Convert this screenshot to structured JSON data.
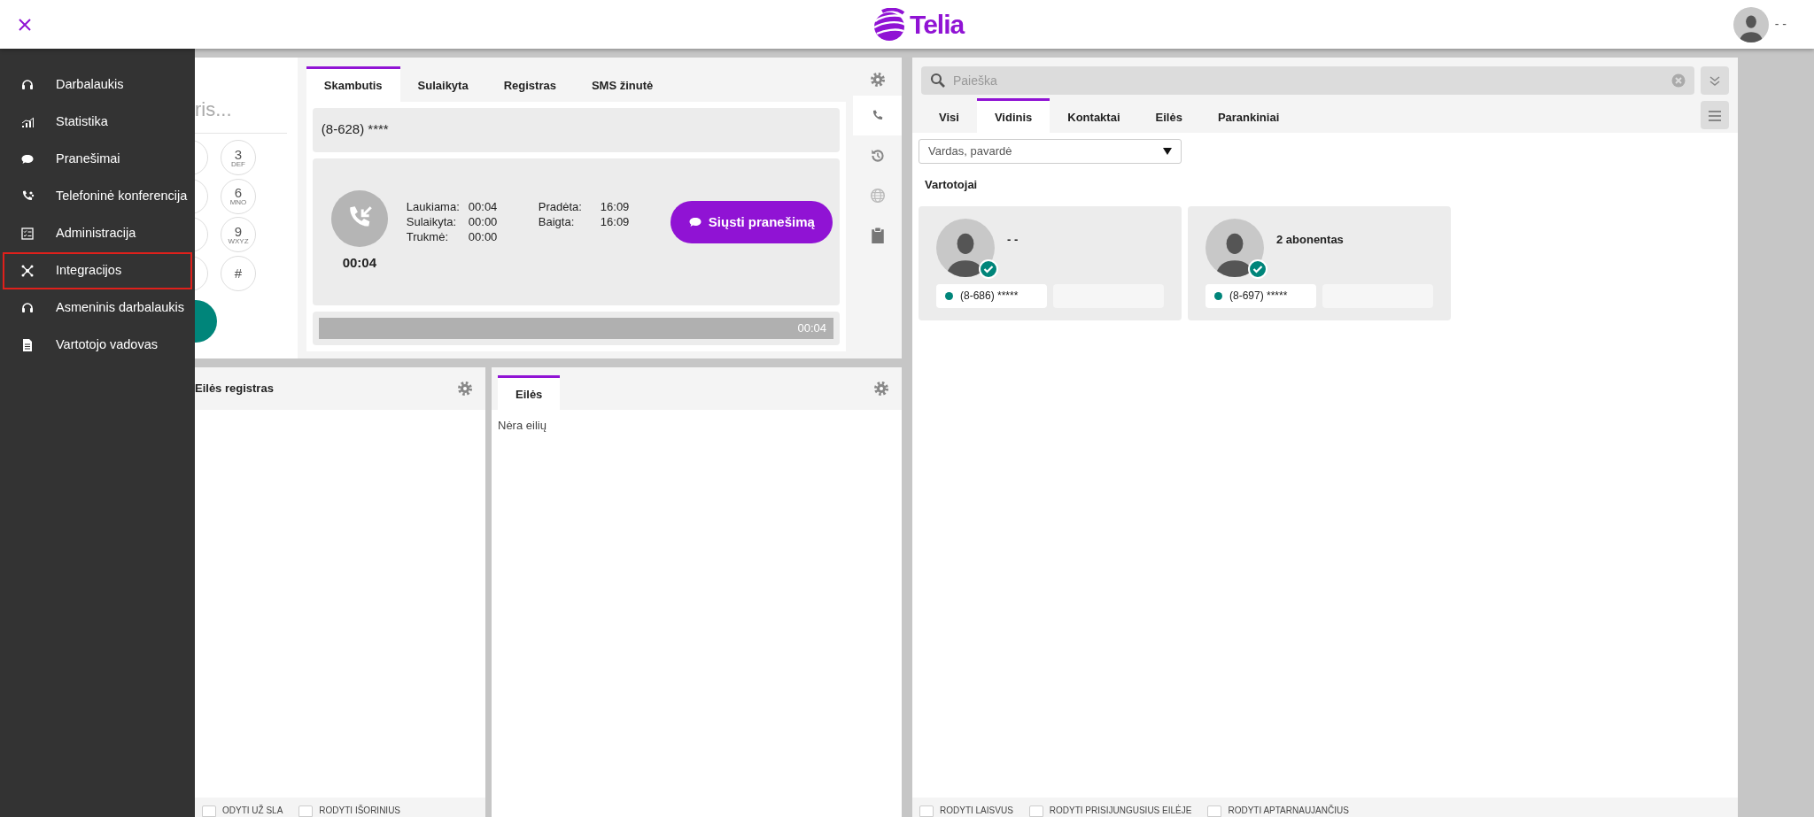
{
  "header": {
    "logo_text": "Telia",
    "user_name": "- -"
  },
  "sidebar": {
    "items": [
      {
        "label": "Darbalaukis",
        "selected": false
      },
      {
        "label": "Statistika",
        "selected": false
      },
      {
        "label": "Pranešimai",
        "selected": false
      },
      {
        "label": "Telefoninė konferencija",
        "selected": false
      },
      {
        "label": "Administracija",
        "selected": false
      },
      {
        "label": "Integracijos",
        "selected": true
      },
      {
        "label": "Asmeninis darbalaukis",
        "selected": false
      },
      {
        "label": "Vartotojo vadovas",
        "selected": false
      }
    ]
  },
  "dialpad": {
    "placeholder": "ris...",
    "keys": [
      {
        "digit": "3",
        "letters": "DEF"
      },
      {
        "digit": "6",
        "letters": "MNO"
      },
      {
        "digit": "9",
        "letters": "WXYZ"
      },
      {
        "digit": "#"
      }
    ]
  },
  "call_panel": {
    "tabs": [
      {
        "label": "Skambutis",
        "selected": true
      },
      {
        "label": "Sulaikyta",
        "selected": false
      },
      {
        "label": "Registras",
        "selected": false
      },
      {
        "label": "SMS žinutė",
        "selected": false
      }
    ],
    "number": "(8-628) ****",
    "call_timer": "00:04",
    "stats": [
      {
        "label": "Laukiama:",
        "value": "00:04"
      },
      {
        "label": "Sulaikyta:",
        "value": "00:00"
      },
      {
        "label": "Trukmė:",
        "value": "00:00"
      },
      {
        "label": "Pradėta:",
        "value": "16:09"
      },
      {
        "label": "Baigta:",
        "value": "16:09"
      }
    ],
    "send_button": "Siųsti pranešimą",
    "progress": {
      "level": 1,
      "reading": "00:04"
    }
  },
  "queue_log": {
    "title": "Eilės registras",
    "options": [
      {
        "label": "ODYTI UŽ SLA",
        "checked": false
      },
      {
        "label": "RODYTI IŠORINIUS",
        "checked": false
      }
    ]
  },
  "queues": {
    "tabs": [
      {
        "label": "Eilės",
        "selected": true
      }
    ],
    "empty_text": "Nėra eilių"
  },
  "directory": {
    "search": {
      "placeholder": "Paieška"
    },
    "tabs": [
      {
        "label": "Visi",
        "selected": false
      },
      {
        "label": "Vidinis",
        "selected": true
      },
      {
        "label": "Kontaktai",
        "selected": false
      },
      {
        "label": "Eilės",
        "selected": false
      },
      {
        "label": "Parankiniai",
        "selected": false
      }
    ],
    "filter": {
      "value": "Vardas, pavardė"
    },
    "section_title": "Vartotojai",
    "users": [
      {
        "name": "- -",
        "phone": "(8-686) *****",
        "color": "#00857a"
      },
      {
        "name": "2 abonentas",
        "phone": "(8-697) *****",
        "color": "#00857a"
      }
    ],
    "options": [
      {
        "label": "RODYTI LAISVUS",
        "checked": false
      },
      {
        "label": "RODYTI PRISIJUNGUSIUS EILĖJE",
        "checked": false
      },
      {
        "label": "RODYTI APTARNAUJANČIUS",
        "checked": false
      }
    ]
  }
}
